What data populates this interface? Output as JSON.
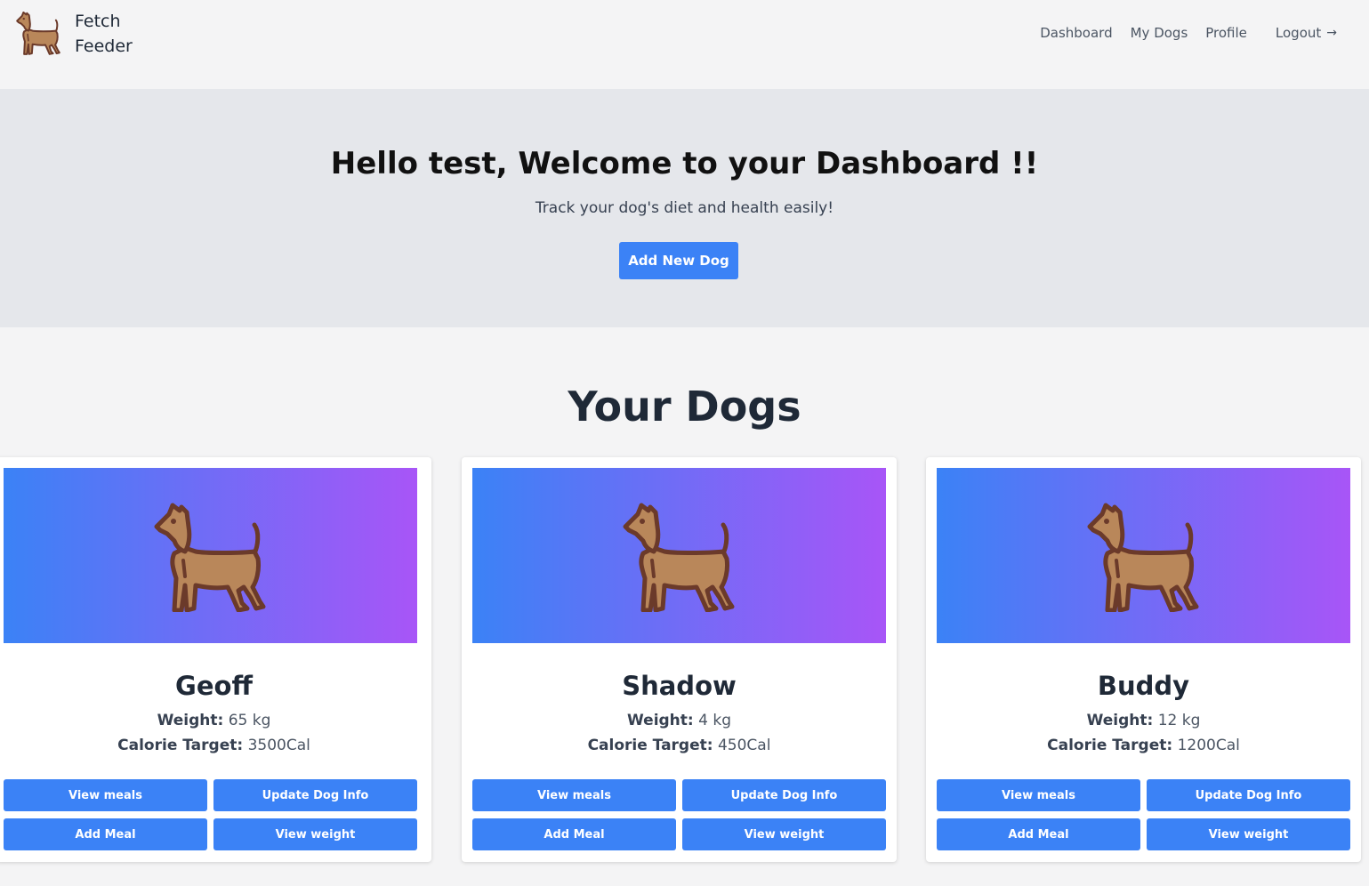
{
  "nav": {
    "brand_line1": "Fetch",
    "brand_line2": "Feeder",
    "links": {
      "dashboard": "Dashboard",
      "my_dogs": "My Dogs",
      "profile": "Profile",
      "logout": "Logout",
      "logout_icon": "arrow-right-icon"
    }
  },
  "hero": {
    "title": "Hello test, Welcome to your Dashboard !!",
    "subtitle": "Track your dog's diet and health easily!",
    "button": "Add New Dog"
  },
  "section_title": "Your Dogs",
  "labels": {
    "weight": "Weight:",
    "calorie": "Calorie Target:"
  },
  "buttons": {
    "view_meals": "View meals",
    "update_info": "Update Dog Info",
    "add_meal": "Add Meal",
    "view_weight": "View weight"
  },
  "dogs": [
    {
      "name": "Geoff",
      "weight": "65 kg",
      "calories": "3500Cal"
    },
    {
      "name": "Shadow",
      "weight": "4 kg",
      "calories": "450Cal"
    },
    {
      "name": "Buddy",
      "weight": "12 kg",
      "calories": "1200Cal"
    }
  ],
  "colors": {
    "primary": "#3b82f6",
    "gradient_start": "#3b82f6",
    "gradient_end": "#a855f7",
    "hero_bg": "#e5e7eb",
    "page_bg": "#f4f4f5"
  },
  "icons": {
    "brand": "dog-icon",
    "card": "dog-icon"
  }
}
